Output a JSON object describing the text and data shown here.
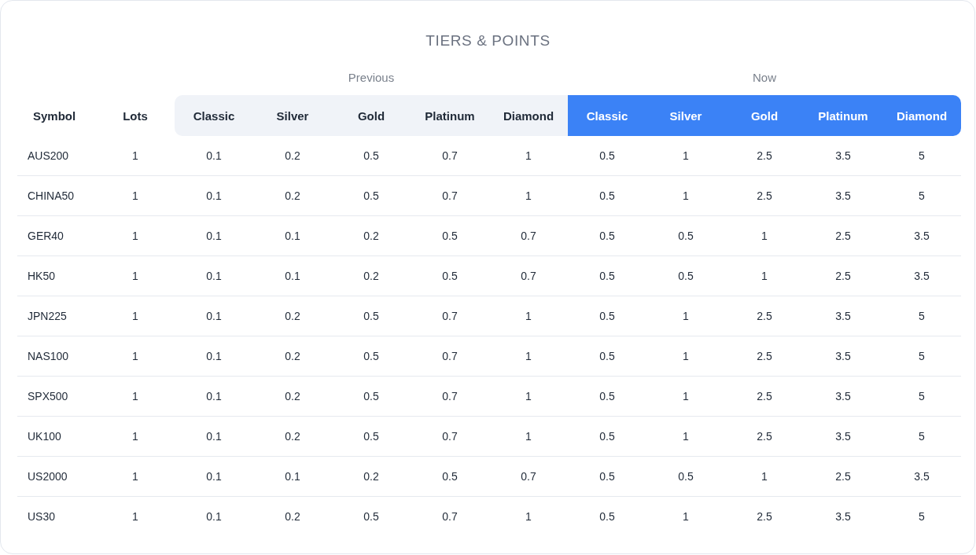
{
  "title": "TIERS & POINTS",
  "table": {
    "columns": [
      "Symbol",
      "Lots"
    ],
    "groups": [
      {
        "label": "Previous",
        "kind": "muted",
        "columns": [
          "Classic",
          "Silver",
          "Gold",
          "Platinum",
          "Diamond"
        ]
      },
      {
        "label": "Now",
        "kind": "highlight",
        "columns": [
          "Classic",
          "Silver",
          "Gold",
          "Platinum",
          "Diamond"
        ]
      }
    ],
    "rows": [
      {
        "cells": [
          "AUS200",
          "1",
          "0.1",
          "0.2",
          "0.5",
          "0.7",
          "1",
          "0.5",
          "1",
          "2.5",
          "3.5",
          "5"
        ]
      },
      {
        "cells": [
          "CHINA50",
          "1",
          "0.1",
          "0.2",
          "0.5",
          "0.7",
          "1",
          "0.5",
          "1",
          "2.5",
          "3.5",
          "5"
        ]
      },
      {
        "cells": [
          "GER40",
          "1",
          "0.1",
          "0.1",
          "0.2",
          "0.5",
          "0.7",
          "0.5",
          "0.5",
          "1",
          "2.5",
          "3.5"
        ]
      },
      {
        "cells": [
          "HK50",
          "1",
          "0.1",
          "0.1",
          "0.2",
          "0.5",
          "0.7",
          "0.5",
          "0.5",
          "1",
          "2.5",
          "3.5"
        ]
      },
      {
        "cells": [
          "JPN225",
          "1",
          "0.1",
          "0.2",
          "0.5",
          "0.7",
          "1",
          "0.5",
          "1",
          "2.5",
          "3.5",
          "5"
        ]
      },
      {
        "cells": [
          "NAS100",
          "1",
          "0.1",
          "0.2",
          "0.5",
          "0.7",
          "1",
          "0.5",
          "1",
          "2.5",
          "3.5",
          "5"
        ]
      },
      {
        "cells": [
          "SPX500",
          "1",
          "0.1",
          "0.2",
          "0.5",
          "0.7",
          "1",
          "0.5",
          "1",
          "2.5",
          "3.5",
          "5"
        ]
      },
      {
        "cells": [
          "UK100",
          "1",
          "0.1",
          "0.2",
          "0.5",
          "0.7",
          "1",
          "0.5",
          "1",
          "2.5",
          "3.5",
          "5"
        ]
      },
      {
        "cells": [
          "US2000",
          "1",
          "0.1",
          "0.1",
          "0.2",
          "0.5",
          "0.7",
          "0.5",
          "0.5",
          "1",
          "2.5",
          "3.5"
        ]
      },
      {
        "cells": [
          "US30",
          "1",
          "0.1",
          "0.2",
          "0.5",
          "0.7",
          "1",
          "0.5",
          "1",
          "2.5",
          "3.5",
          "5"
        ]
      }
    ]
  }
}
